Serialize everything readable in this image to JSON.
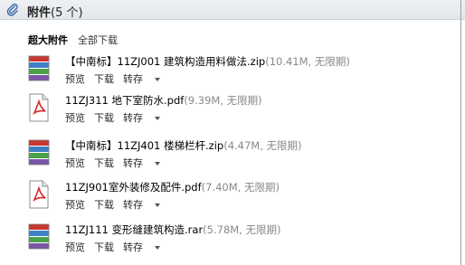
{
  "header": {
    "title": "附件",
    "count": "(5 个)"
  },
  "toolbar": {
    "super_label": "超大附件",
    "download_all": "全部下载"
  },
  "actions": {
    "preview": "预览",
    "download": "下载",
    "save": "转存"
  },
  "attachments": [
    {
      "icon": "zip-archive-icon",
      "name": "【中南标】11ZJ001 建筑构造用料做法.zip",
      "meta": "(10.41M, 无限期)"
    },
    {
      "icon": "pdf-icon",
      "name": "11ZJ311 地下室防水.pdf",
      "meta": "(9.39M, 无限期)"
    },
    {
      "icon": "zip-archive-icon",
      "name": "【中南标】11ZJ401 楼梯栏杆.zip",
      "meta": "(4.47M, 无限期)"
    },
    {
      "icon": "pdf-icon",
      "name": "11ZJ901室外装修及配件.pdf",
      "meta": "(7.40M, 无限期)"
    },
    {
      "icon": "rar-archive-icon",
      "name": "11ZJ111 变形缝建筑构造.rar",
      "meta": "(5.78M, 无限期)"
    }
  ]
}
